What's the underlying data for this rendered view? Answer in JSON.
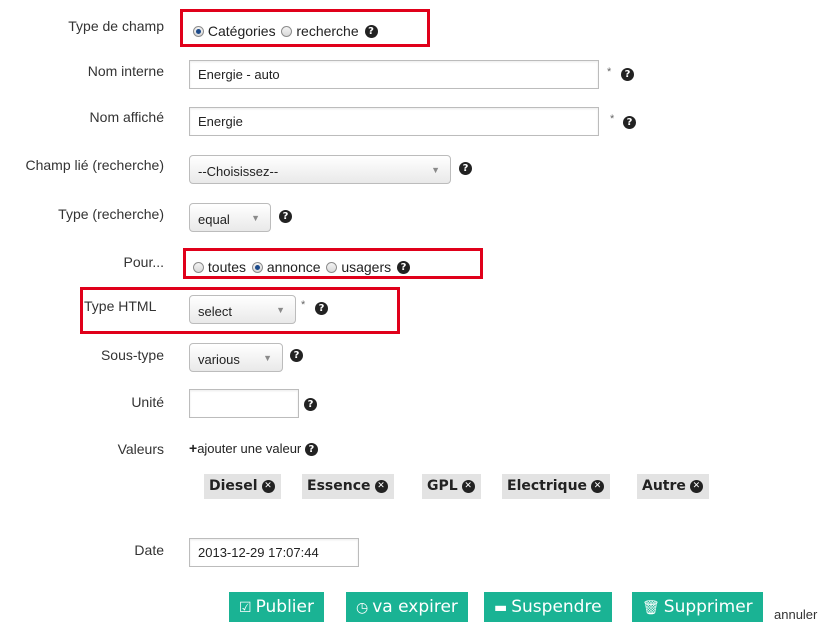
{
  "fields": {
    "type_champ": {
      "label": "Type de champ",
      "options": [
        "Catégories",
        "recherche"
      ],
      "selected": "Catégories"
    },
    "nom_interne": {
      "label": "Nom interne",
      "value": "Energie - auto",
      "required_mark": "*"
    },
    "nom_affiche": {
      "label": "Nom affiché",
      "value": "Energie",
      "required_mark": "*"
    },
    "champ_lie": {
      "label": "Champ lié (recherche)",
      "value": "--Choisissez--"
    },
    "type_recherche": {
      "label": "Type (recherche)",
      "value": "equal"
    },
    "pour": {
      "label": "Pour...",
      "options": [
        "toutes",
        "annonce",
        "usagers"
      ],
      "selected": "annonce"
    },
    "type_html": {
      "label": "Type HTML",
      "value": "select",
      "required_mark": "*"
    },
    "sous_type": {
      "label": "Sous-type",
      "value": "various"
    },
    "unite": {
      "label": "Unité",
      "value": ""
    },
    "valeurs": {
      "label": "Valeurs",
      "add_link": "ajouter une valeur",
      "items": [
        "Diesel",
        "Essence",
        "GPL",
        "Electrique",
        "Autre"
      ]
    },
    "date": {
      "label": "Date",
      "value": "2013-12-29 17:07:44"
    }
  },
  "actions": {
    "publier": "Publier",
    "va_expirer": "va expirer",
    "suspendre": "Suspendre",
    "supprimer": "Supprimer",
    "annuler": "annuler"
  },
  "icons": {
    "help": "question-circle-icon",
    "remove": "times-circle-icon",
    "plus": "plus-icon",
    "check": "check-square-icon",
    "clock": "clock-icon",
    "minus": "minus-square-icon",
    "trash": "trash-icon"
  },
  "colors": {
    "accent": "#1ab394",
    "highlight_box": "#e0001a",
    "tag_bg": "#e3e3e3"
  }
}
